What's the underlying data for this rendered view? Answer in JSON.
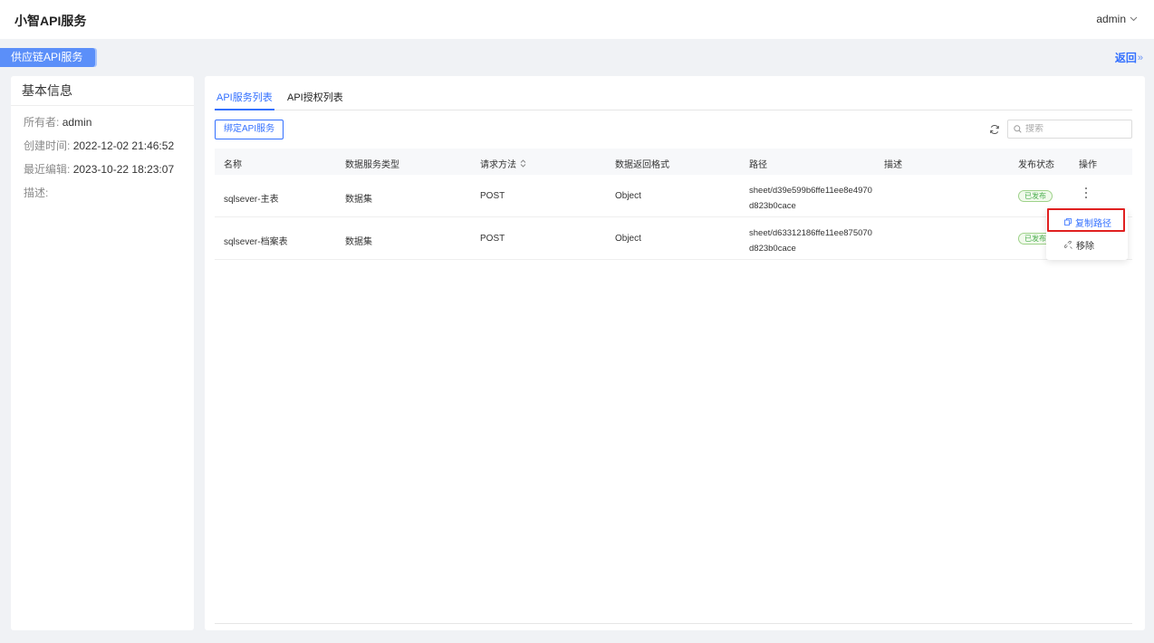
{
  "header": {
    "app_title": "小智API服务",
    "user_name": "admin",
    "user_menu_icon": "chevron-down-icon"
  },
  "service_tag": "供应链API服务",
  "back_link": "返回",
  "info_panel": {
    "title": "基本信息",
    "owner_label": "所有者:",
    "owner_value": "admin",
    "created_label": "创建时间:",
    "created_value": "2022-12-02 21:46:52",
    "edited_label": "最近编辑:",
    "edited_value": "2023-10-22 18:23:07",
    "desc_label": "描述:",
    "desc_value": ""
  },
  "tabs": [
    {
      "label": "API服务列表",
      "active": true
    },
    {
      "label": "API授权列表",
      "active": false
    }
  ],
  "toolbar": {
    "bind_button": "绑定API服务",
    "search_placeholder": "搜索"
  },
  "table": {
    "columns": [
      "名称",
      "数据服务类型",
      "请求方法",
      "数据返回格式",
      "路径",
      "描述",
      "发布状态",
      "操作"
    ],
    "rows": [
      {
        "name": "sqlsever-主表",
        "type": "数据集",
        "method": "POST",
        "format": "Object",
        "path_line1": "sheet/d39e599b6ffe11ee8e4970",
        "path_line2": "d823b0cace",
        "desc": "",
        "status": "已发布"
      },
      {
        "name": "sqlsever-档案表",
        "type": "数据集",
        "method": "POST",
        "format": "Object",
        "path_line1": "sheet/d63312186ffe11ee875070",
        "path_line2": "d823b0cace",
        "desc": "",
        "status": "已发布"
      }
    ]
  },
  "dropdown": {
    "copy_path": "复制路径",
    "remove": "移除"
  },
  "colors": {
    "primary": "#3370ff",
    "tag_bg": "#5b8ff9",
    "success": "#4caf50",
    "highlight": "#e02020"
  }
}
